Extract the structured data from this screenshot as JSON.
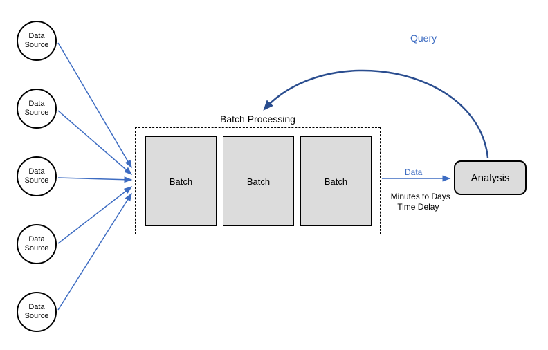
{
  "data_sources": [
    {
      "label": "Data\nSource"
    },
    {
      "label": "Data\nSource"
    },
    {
      "label": "Data\nSource"
    },
    {
      "label": "Data\nSource"
    },
    {
      "label": "Data\nSource"
    }
  ],
  "batch_processing": {
    "title": "Batch Processing",
    "batches": [
      {
        "label": "Batch"
      },
      {
        "label": "Batch"
      },
      {
        "label": "Batch"
      }
    ]
  },
  "analysis": {
    "label": "Analysis"
  },
  "labels": {
    "data": "Data",
    "delay": "Minutes to Days\nTime Delay",
    "query": "Query"
  }
}
